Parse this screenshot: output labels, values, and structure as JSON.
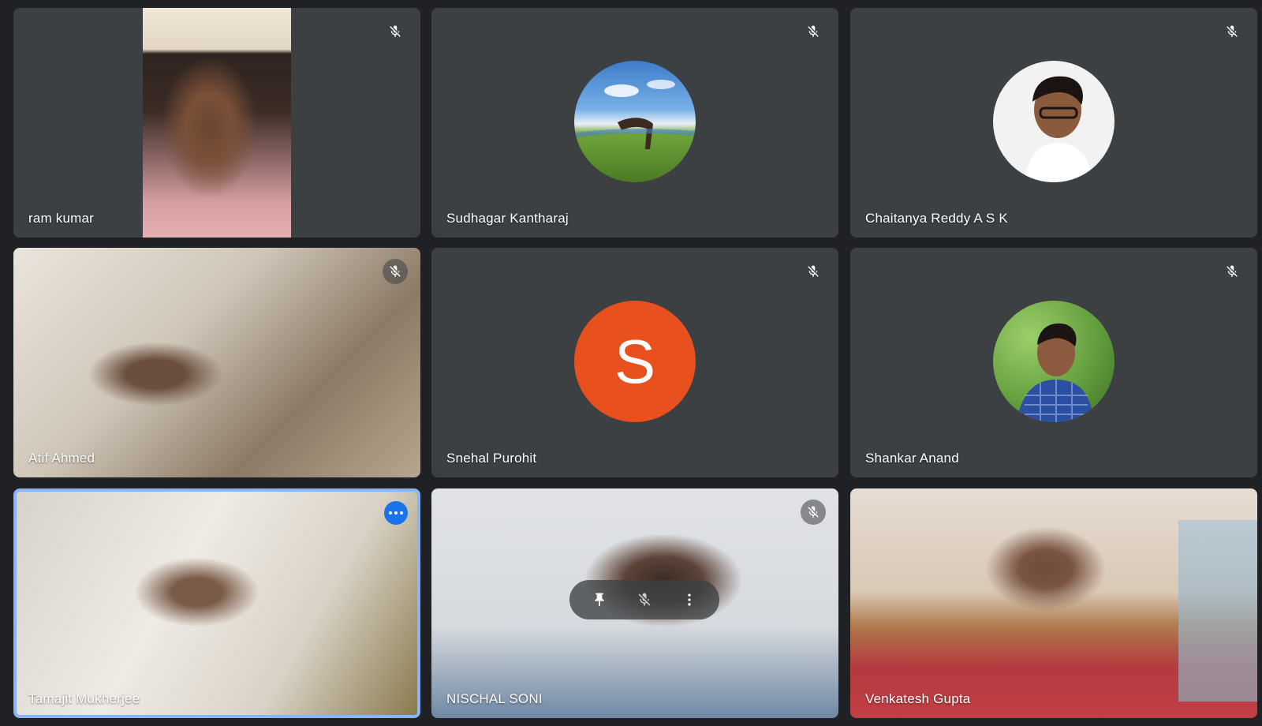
{
  "participants": [
    {
      "name": "ram kumar",
      "muted": true,
      "feed": "video"
    },
    {
      "name": "Sudhagar Kantharaj",
      "muted": true,
      "feed": "photo-avatar"
    },
    {
      "name": "Chaitanya Reddy A S K",
      "muted": true,
      "feed": "photo-avatar"
    },
    {
      "name": "Atif Ahmed",
      "muted": true,
      "feed": "video"
    },
    {
      "name": "Snehal Purohit",
      "muted": true,
      "feed": "letter-avatar",
      "initial": "S",
      "avatar_color": "#e8501e"
    },
    {
      "name": "Shankar Anand",
      "muted": true,
      "feed": "photo-avatar"
    },
    {
      "name": "Tamajit Mukherjee",
      "muted": false,
      "feed": "video",
      "active_speaker": true
    },
    {
      "name": "NISCHAL SONI",
      "muted": true,
      "feed": "video"
    },
    {
      "name": "Venkatesh Gupta",
      "muted": false,
      "feed": "video"
    }
  ],
  "colors": {
    "background": "#202124",
    "tile": "#3c4043",
    "active_border": "#8ab4f8",
    "more_button": "#1a73e8"
  },
  "icons": {
    "mute": "mic-off-icon",
    "more": "more-options-icon",
    "pin": "pin-icon",
    "mute_toggle": "mic-off-icon",
    "overflow": "vertical-dots-icon"
  }
}
